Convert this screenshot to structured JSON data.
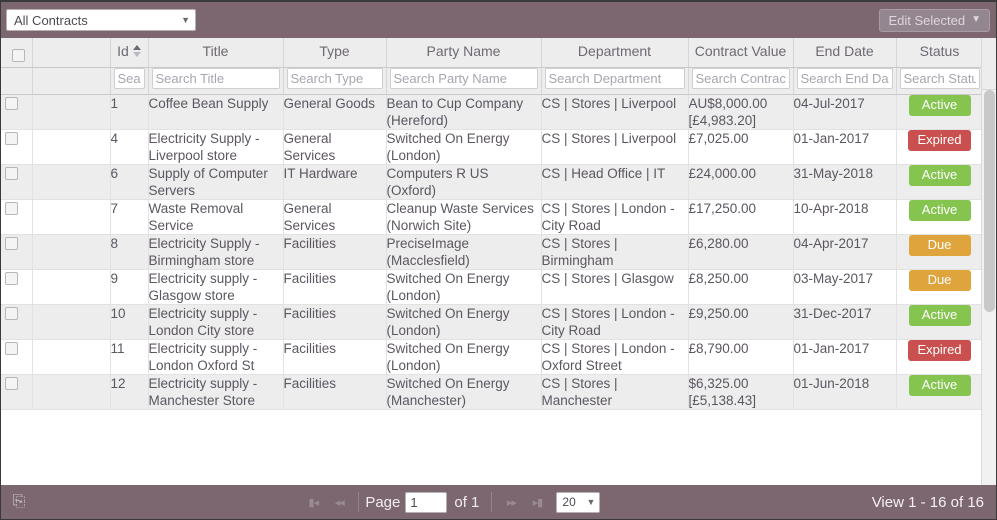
{
  "toolbar": {
    "filter_value": "All Contracts",
    "filter_caret": "chevron-down-icon",
    "edit_selected_label": "Edit Selected"
  },
  "grid": {
    "columns": [
      {
        "key": "check",
        "label": "",
        "placeholder": ""
      },
      {
        "key": "blank",
        "label": "",
        "placeholder": ""
      },
      {
        "key": "id",
        "label": "Id",
        "placeholder": "Search Id"
      },
      {
        "key": "title",
        "label": "Title",
        "placeholder": "Search Title"
      },
      {
        "key": "type",
        "label": "Type",
        "placeholder": "Search Type"
      },
      {
        "key": "party",
        "label": "Party Name",
        "placeholder": "Search Party Name"
      },
      {
        "key": "dept",
        "label": "Department",
        "placeholder": "Search Department"
      },
      {
        "key": "value",
        "label": "Contract Value",
        "placeholder": "Search Contract Value"
      },
      {
        "key": "enddate",
        "label": "End Date",
        "placeholder": "Search End Date"
      },
      {
        "key": "status",
        "label": "Status",
        "placeholder": "Search Status"
      }
    ],
    "sorted_column": "id",
    "sort_direction": "asc",
    "rows": [
      {
        "id": "1",
        "title": "Coffee Bean Supply",
        "type": "General Goods",
        "party": "Bean to Cup Company (Hereford)",
        "dept": "CS | Stores | Liverpool",
        "value": "AU$8,000.00 [£4,983.20]",
        "enddate": "04-Jul-2017",
        "status": "Active"
      },
      {
        "id": "4",
        "title": "Electricity Supply - Liverpool store",
        "type": "General Services",
        "party": "Switched On Energy (London)",
        "dept": "CS | Stores | Liverpool",
        "value": "£7,025.00",
        "enddate": "01-Jan-2017",
        "status": "Expired"
      },
      {
        "id": "6",
        "title": "Supply of Computer Servers",
        "type": "IT Hardware",
        "party": "Computers R US (Oxford)",
        "dept": "CS | Head Office | IT",
        "value": "£24,000.00",
        "enddate": "31-May-2018",
        "status": "Active"
      },
      {
        "id": "7",
        "title": "Waste Removal Service",
        "type": "General Services",
        "party": "Cleanup Waste Services (Norwich Site)",
        "dept": "CS | Stores | London - City Road",
        "value": "£17,250.00",
        "enddate": "10-Apr-2018",
        "status": "Active"
      },
      {
        "id": "8",
        "title": "Electricity Supply - Birmingham store",
        "type": "Facilities",
        "party": "PreciseImage (Macclesfield)",
        "dept": "CS | Stores | Birmingham",
        "value": "£6,280.00",
        "enddate": "04-Apr-2017",
        "status": "Due"
      },
      {
        "id": "9",
        "title": "Electricity supply - Glasgow store",
        "type": "Facilities",
        "party": "Switched On Energy (London)",
        "dept": "CS | Stores | Glasgow",
        "value": "£8,250.00",
        "enddate": "03-May-2017",
        "status": "Due"
      },
      {
        "id": "10",
        "title": "Electricity supply - London City store",
        "type": "Facilities",
        "party": "Switched On Energy (London)",
        "dept": "CS | Stores | London - City Road",
        "value": "£9,250.00",
        "enddate": "31-Dec-2017",
        "status": "Active"
      },
      {
        "id": "11",
        "title": "Electricity supply - London Oxford St",
        "type": "Facilities",
        "party": "Switched On Energy (London)",
        "dept": "CS | Stores | London - Oxford Street",
        "value": "£8,790.00",
        "enddate": "01-Jan-2017",
        "status": "Expired"
      },
      {
        "id": "12",
        "title": "Electricity supply - Manchester Store",
        "type": "Facilities",
        "party": "Switched On Energy (Manchester)",
        "dept": "CS | Stores | Manchester",
        "value": "$6,325.00 [£5,138.43]",
        "enddate": "01-Jun-2018",
        "status": "Active"
      }
    ],
    "status_colors": {
      "Active": "#85c44f",
      "Expired": "#c9504e",
      "Due": "#e0a43c"
    }
  },
  "footer": {
    "refresh_icon": "refresh-icon",
    "first_page_icon": "first-page-icon",
    "prev_page_icon": "previous-page-icon",
    "next_page_icon": "next-page-icon",
    "last_page_icon": "last-page-icon",
    "page_label": "Page",
    "page_value": "1",
    "page_of": "of 1",
    "page_size": "20",
    "page_size_caret": "chevron-down-icon",
    "view_count": "View 1 - 16 of 16"
  }
}
